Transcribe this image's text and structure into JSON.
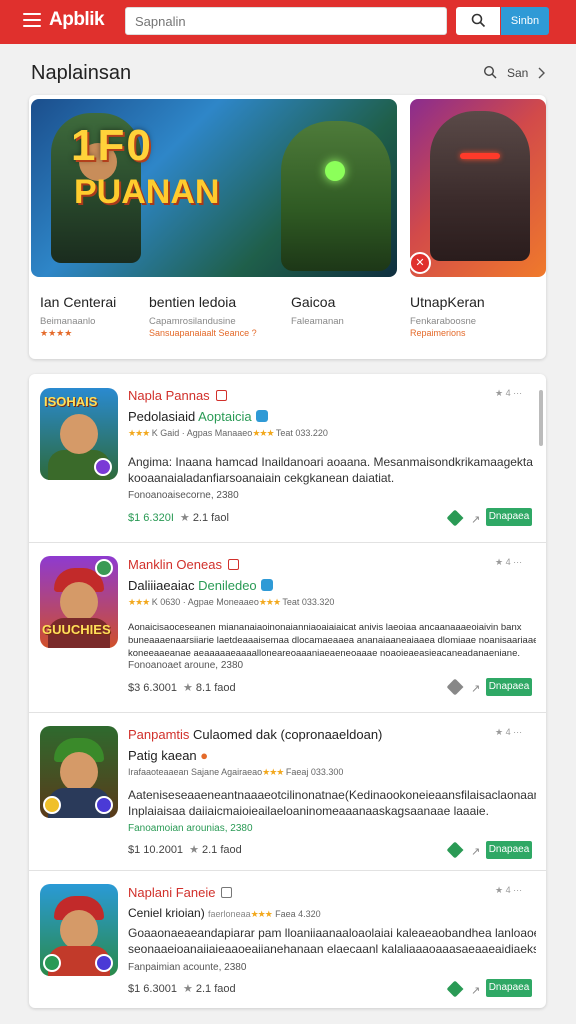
{
  "header": {
    "logo": "Apblik",
    "search_placeholder": "Sapnalin",
    "signin_label": "Sinbn",
    "colors": {
      "bar": "#e0302d",
      "accent": "#2f9ad6",
      "green": "#2fa865"
    }
  },
  "featured": {
    "title": "Naplainsan",
    "see_label": "San",
    "banner_title_1": "1F0",
    "banner_title_2": "PUANAN",
    "cards": [
      {
        "name": "Ian Centerai",
        "sub": "Beimanaanlo",
        "meta": "★★★★"
      },
      {
        "name": "bentien ledoia",
        "sub": "Capamrosilandusine",
        "meta": "Sansuapanaiaalt Seance ?"
      },
      {
        "name": "Gaicoa",
        "sub": "Faleamanan",
        "meta": ""
      },
      {
        "name": "UtnapKeran",
        "sub": "Fenkaraboosne",
        "meta": "Repaimerions"
      }
    ]
  },
  "apps": [
    {
      "title": "Napla Pannas",
      "subtitle": "Pedolasiaid",
      "tag": "Aoptaicia",
      "rating_text": "K Gaid · Agpas Manaaeo",
      "rating_extra": "Teat 033.220",
      "top_right": "★ 4 ···",
      "desc": [
        "Angima: Inaana hamcad Inaildanoari aoaana. Mesanmaisondkrikamaagekta",
        "kooaanaialadanfiarsoanaiain cekgkanean daiatiat."
      ],
      "meta": "Fonoanoaisecorne, 2380",
      "price": "$1 6.320I",
      "stars": "2.1 faol",
      "button": "Dnapaea"
    },
    {
      "title": "Manklin Oeneas",
      "subtitle": "Daliiiaeaiac",
      "tag": "Deniledeo",
      "rating_text": "K 0630 · Agpae Moneaaeo",
      "rating_extra": "Teat 033.320",
      "top_right": "★ 4 ···",
      "desc": [
        "Aonaicisaoceseanen miananaiaoinonaianniaoaiaiaicat anivis laeoiaa ancaanaaaeoiaivin banx",
        "buneaaaenaarsiiarie laetdeaaaisemaa dlocamaeaaea ananaiaaneaiaaea dlomiaae noanisaariaaeeasrn",
        "koneeaaeanae aeaaaaaeaaaalloneareoaaaniaeaeneoaaae noaoieaeasieacaneadanaeniane."
      ],
      "meta": "Fonoanoaet aroune, 2380",
      "price": "$3 6.3001",
      "stars": "8.1 faod",
      "button": "Dnapaea"
    },
    {
      "title": "Panpamtis",
      "title_rest": "Culaomed dak (copronaaeldoan)",
      "subtitle": "Patig kaean",
      "rating_text": "Irafaaoteaaean Sajane Agairaeao",
      "rating_extra": "Faeaj 033.300",
      "top_right": "★ 4 ···",
      "desc": [
        "Aateniseseaaeneantnaaaeotcilinonatnae(Kedinaookoneieaansfilaisaclaonaan",
        "Inplaiaisaa daiiaicmaioieailaeloaninomeaaanaaskagsaanaae laaaie."
      ],
      "meta": "Fanoamoian arounias, 2380",
      "price": "$1 10.2001",
      "stars": "2.1 faod",
      "button": "Dnapaea"
    },
    {
      "title": "Naplani Faneie",
      "subtitle": "Ceniel krioian)",
      "tag": "faerloneaa",
      "rating_text": "",
      "rating_extra": "Faea 4.320",
      "top_right": "★ 4 ···",
      "desc": [
        "Goaaonaeaeandapiarar pam lloaniiaanaaloaolaiai kaleaeaobandhea lanloaoeaan kala",
        "seonaaeioanaiiaieaaoeaiianehanaan elaecaanl kalaliaaaoaaasaeaaeaidiaeks."
      ],
      "meta": "Fanpaimian acounte, 2380",
      "price": "$1 6.3001",
      "stars": "2.1 faod",
      "button": "Dnapaea"
    }
  ]
}
